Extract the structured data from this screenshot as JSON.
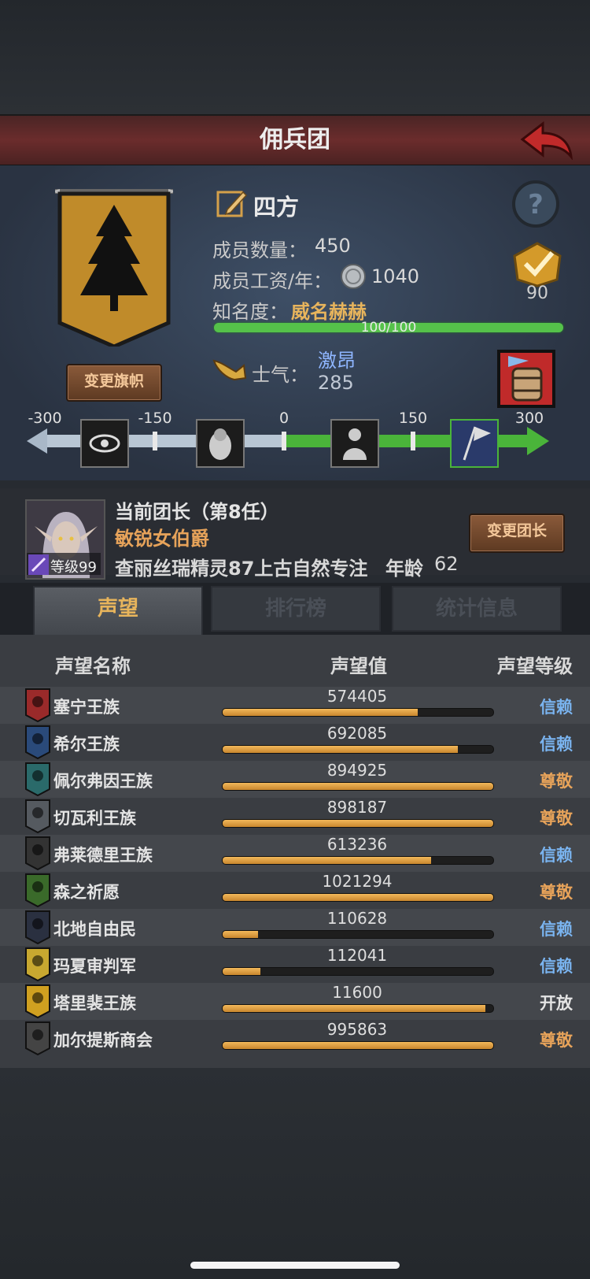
{
  "header": {
    "title": "佣兵团"
  },
  "company": {
    "name": "四方",
    "banner_button": "变更旗帜",
    "members_label": "成员数量：",
    "members": "450",
    "wage_label": "成员工资/年：",
    "wage": "1040",
    "fame_label": "知名度：",
    "fame_state": "威名赫赫",
    "fame_text": "100/100",
    "fame_progress": 1.0,
    "rank": "90",
    "morale_label": "士气：",
    "morale_state": "激昂",
    "morale": "285"
  },
  "morale_scale": {
    "ticks": [
      "-300",
      "-150",
      "0",
      "150",
      "300"
    ],
    "value": 285,
    "icons": [
      "eye-terror-icon",
      "despair-icon",
      "calm-icon",
      "victory-flag-icon"
    ]
  },
  "leader": {
    "title": "当前团长（第8任）",
    "rank_title": "敏锐女伯爵",
    "info": "查丽丝瑞精灵87上古自然专注",
    "age_label": "年龄",
    "age": "62",
    "level": "等级99",
    "change_button": "变更团长"
  },
  "tabs": [
    "声望",
    "排行榜",
    "统计信息"
  ],
  "table": {
    "headers": [
      "声望名称",
      "声望值",
      "声望等级"
    ],
    "rows": [
      {
        "name": "塞宁王族",
        "value": "574405",
        "level": "信赖",
        "progress": 0.72,
        "color": "#7ab4f0",
        "crest": "#9a2a2a"
      },
      {
        "name": "希尔王族",
        "value": "692085",
        "level": "信赖",
        "progress": 0.87,
        "color": "#7ab4f0",
        "crest": "#2a4a7a"
      },
      {
        "name": "佩尔弗因王族",
        "value": "894925",
        "level": "尊敬",
        "progress": 1.0,
        "color": "#e7a35a",
        "crest": "#2a6a6a"
      },
      {
        "name": "切瓦利王族",
        "value": "898187",
        "level": "尊敬",
        "progress": 1.0,
        "color": "#e7a35a",
        "crest": "#555a60"
      },
      {
        "name": "弗莱德里王族",
        "value": "613236",
        "level": "信赖",
        "progress": 0.77,
        "color": "#7ab4f0",
        "crest": "#333333"
      },
      {
        "name": "森之祈愿",
        "value": "1021294",
        "level": "尊敬",
        "progress": 1.0,
        "color": "#e7a35a",
        "crest": "#3a6a2a"
      },
      {
        "name": "北地自由民",
        "value": "110628",
        "level": "信赖",
        "progress": 0.13,
        "color": "#7ab4f0",
        "crest": "#2a3040"
      },
      {
        "name": "玛夏审判军",
        "value": "112041",
        "level": "信赖",
        "progress": 0.14,
        "color": "#7ab4f0",
        "crest": "#c8a830"
      },
      {
        "name": "塔里裴王族",
        "value": "11600",
        "level": "开放",
        "progress": 0.97,
        "color": "#e4e4e4",
        "crest": "#d0a020"
      },
      {
        "name": "加尔提斯商会",
        "value": "995863",
        "level": "尊敬",
        "progress": 1.0,
        "color": "#e7a35a",
        "crest": "#444444"
      }
    ]
  },
  "colors": {
    "accent": "#e7b45c",
    "trust": "#7ab4f0",
    "respect": "#e7a35a",
    "morale_green": "#4ab43a"
  }
}
